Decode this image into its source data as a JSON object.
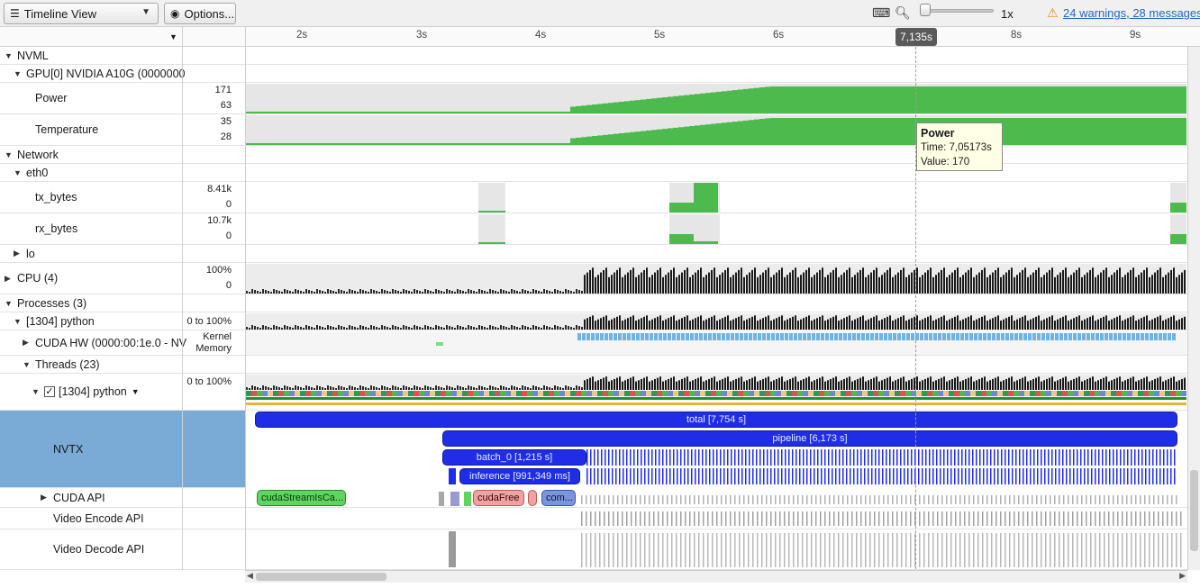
{
  "toolbar": {
    "view_select": "Timeline View",
    "options_label": "Options...",
    "zoom_speed": "1x",
    "warnings_link": "24 warnings, 28 messages"
  },
  "ruler": {
    "ticks": [
      "2s",
      "3s",
      "4s",
      "5s",
      "6s",
      "8s",
      "9s"
    ],
    "cursor_time": "7,135s"
  },
  "tree": {
    "nvml": "NVML",
    "gpu": "GPU[0] NVIDIA A10G (0000000",
    "power": {
      "label": "Power",
      "max": "171",
      "min": "63"
    },
    "temperature": {
      "label": "Temperature",
      "max": "35",
      "min": "28"
    },
    "network": "Network",
    "eth0": "eth0",
    "tx_bytes": {
      "label": "tx_bytes",
      "max": "8.41k",
      "min": "0"
    },
    "rx_bytes": {
      "label": "rx_bytes",
      "max": "10.7k",
      "min": "0"
    },
    "lo": "lo",
    "cpu": {
      "label": "CPU (4)",
      "max": "100%",
      "min": "0"
    },
    "processes": "Processes (3)",
    "python_proc": {
      "label": "[1304] python",
      "range": "0 to 100%"
    },
    "cuda_hw": {
      "label": "CUDA HW (0000:00:1e.0 - NV",
      "kernel": "Kernel",
      "memory": "Memory"
    },
    "threads": "Threads (23)",
    "python_thread": {
      "label": "[1304] python",
      "range": "0 to 100%"
    },
    "nvtx": "NVTX",
    "cuda_api": "CUDA API",
    "video_encode": "Video Encode API",
    "video_decode": "Video Decode API"
  },
  "nvtx_ranges": {
    "total": "total [7,754 s]",
    "pipeline": "pipeline [6,173 s]",
    "batch": "batch_0 [1,215 s]",
    "inference": "inference [991,349 ms]"
  },
  "cuda_api_calls": {
    "stream": "cudaStreamIsCa...",
    "free": "cudaFree",
    "com": "com..."
  },
  "tooltip": {
    "title": "Power",
    "time": "Time: 7,05173s",
    "value": "Value: 170"
  },
  "colors": {
    "metric_green": "#4cba4c",
    "nvtx_blue": "#1f2ee6",
    "nvtx_selected_bg": "#7aabd6",
    "kernel_blue": "#6fb3e6"
  }
}
